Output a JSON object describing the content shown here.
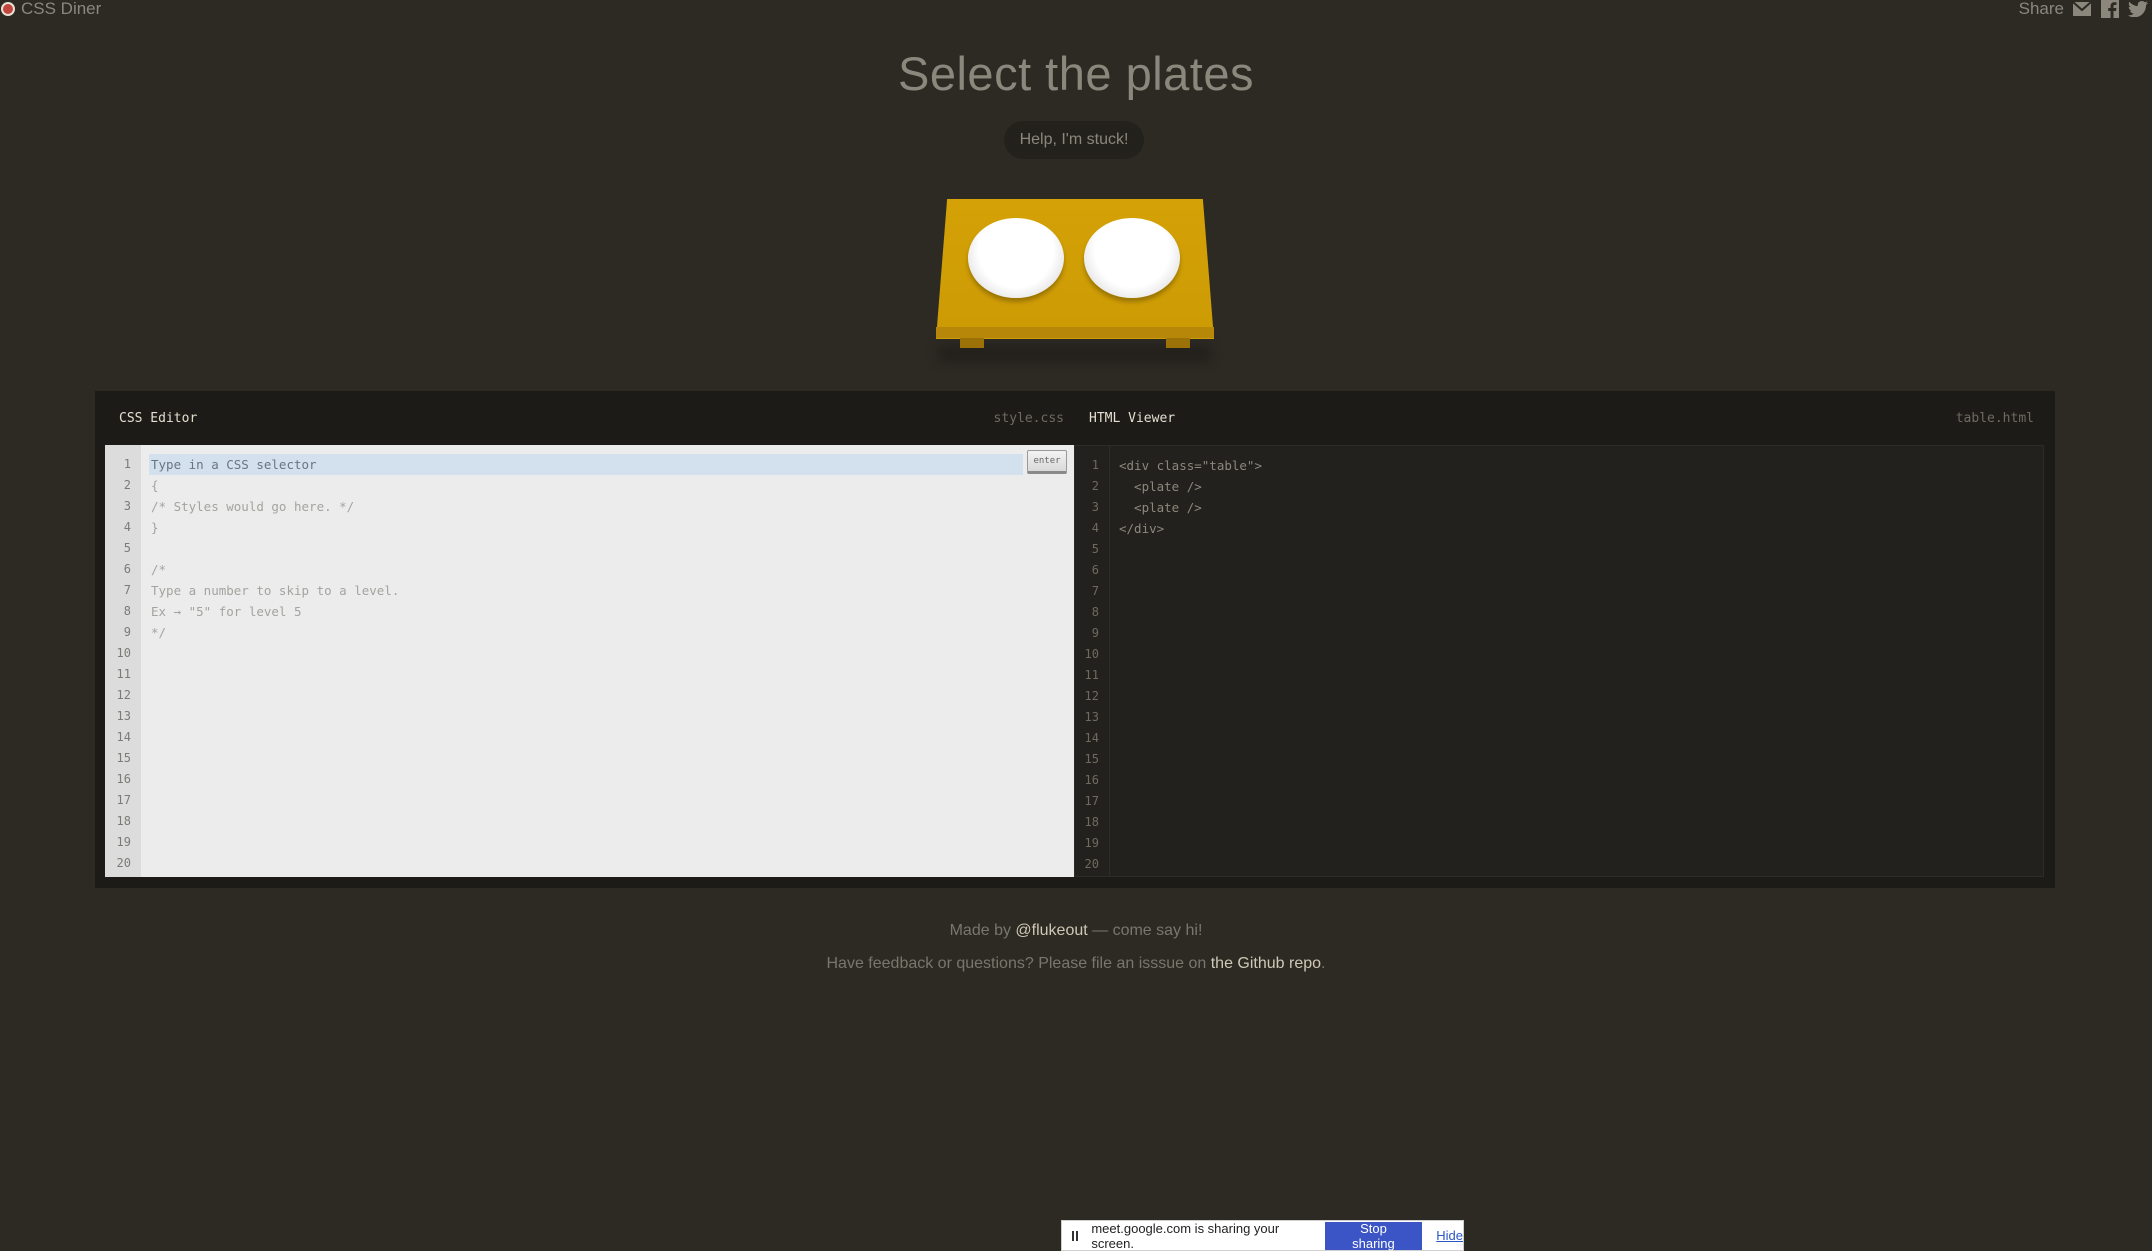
{
  "app": {
    "logo_text": "CSS Diner",
    "share_label": "Share",
    "share_icons": [
      "envelope-icon",
      "facebook-icon",
      "twitter-icon"
    ]
  },
  "level": {
    "title": "Select the plates",
    "help_label": "Help, I'm stuck!"
  },
  "css_editor": {
    "title": "CSS Editor",
    "filename": "style.css",
    "input_placeholder": "Type in a CSS selector",
    "input_value": "",
    "enter_label": "enter",
    "code_lines": [
      "{",
      "/* Styles would go here. */",
      "}",
      "",
      "/*",
      "Type a number to skip to a level.",
      "Ex → \"5\" for level 5",
      "*/"
    ],
    "line_count": 20
  },
  "html_viewer": {
    "title": "HTML Viewer",
    "filename": "table.html",
    "code_lines": [
      "<div class=\"table\">",
      "  <plate />",
      "  <plate />",
      "</div>"
    ],
    "line_count": 20
  },
  "footer": {
    "made_by_prefix": "Made by ",
    "made_by_link": "@flukeout",
    "made_by_suffix": " — come say hi!",
    "feedback_prefix": "Have feedback or questions? Please file an isssue on ",
    "feedback_link": "the Github repo",
    "feedback_suffix": "."
  },
  "screen_share": {
    "message": "meet.google.com is sharing your screen.",
    "stop_label": "Stop sharing",
    "hide_label": "Hide"
  },
  "colors": {
    "background": "#2d2a24",
    "table": "#d4a206",
    "plate": "#ffffff",
    "stop_button": "#3c55c6"
  }
}
